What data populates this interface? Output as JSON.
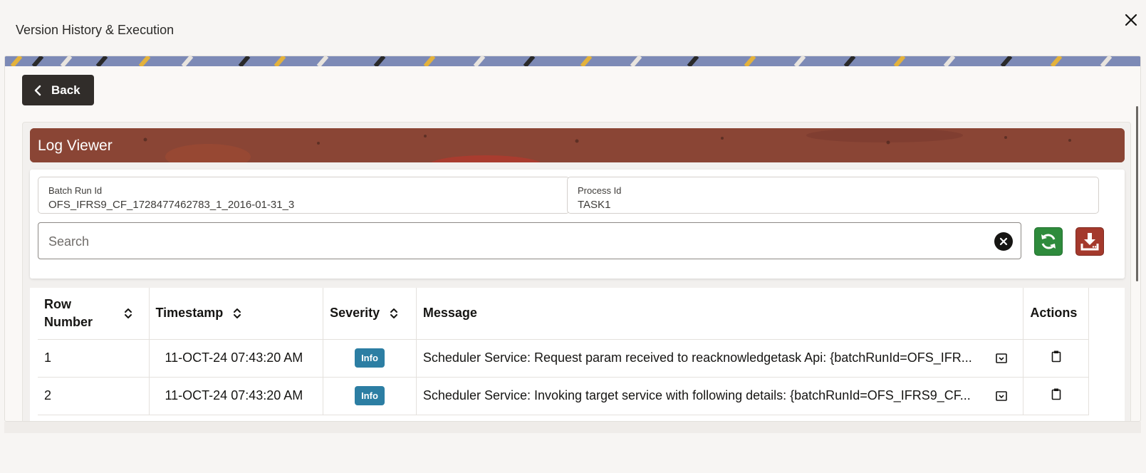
{
  "dialog": {
    "title": "Version History & Execution"
  },
  "toolbar": {
    "back_label": "Back"
  },
  "log_viewer": {
    "title": "Log Viewer",
    "batch_run": {
      "label": "Batch Run Id",
      "value": "OFS_IFRS9_CF_1728477462783_1_2016-01-31_3"
    },
    "process": {
      "label": "Process Id",
      "value": "TASK1"
    },
    "search": {
      "placeholder": "Search"
    }
  },
  "table": {
    "columns": {
      "row_number": "Row Number",
      "timestamp": "Timestamp",
      "severity": "Severity",
      "message": "Message",
      "actions": "Actions"
    },
    "rows": [
      {
        "row": "1",
        "timestamp": "11-OCT-24 07:43:20 AM",
        "severity": "Info",
        "message": "Scheduler Service: Request param received to reacknowledgetask Api: {batchRunId=OFS_IFR..."
      },
      {
        "row": "2",
        "timestamp": "11-OCT-24 07:43:20 AM",
        "severity": "Info",
        "message": "Scheduler Service: Invoking target service with following details: {batchRunId=OFS_IFRS9_CF..."
      }
    ]
  },
  "colors": {
    "header_brown": "#8a4535",
    "back_button": "#312d2a",
    "refresh_green": "#2e8b3c",
    "download_red": "#a4392c",
    "info_badge": "#2c7ea3"
  },
  "icons": {
    "close": "close-icon",
    "back": "chevron-left-icon",
    "clear": "clear-search-icon",
    "refresh": "refresh-icon",
    "download": "download-icon",
    "sort": "sort-icon",
    "expand": "expand-message-icon",
    "copy": "clipboard-icon"
  }
}
